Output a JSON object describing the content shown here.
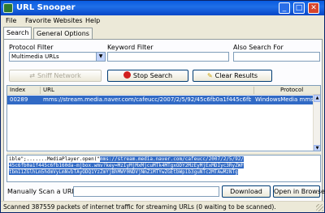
{
  "window": {
    "title": "URL Snooper"
  },
  "titlebar_buttons": {
    "minimize": "_",
    "maximize": "□",
    "close": "✕"
  },
  "menu": [
    "File",
    "Favorite Websites",
    "Help"
  ],
  "tabs": [
    "Search",
    "General Options"
  ],
  "filters": {
    "protocol_label": "Protocol Filter",
    "protocol_value": "Multimedia URLs",
    "keyword_label": "Keyword Filter",
    "keyword_value": "",
    "also_label": "Also Search For",
    "also_value": ""
  },
  "buttons": {
    "sniff": "Sniff Network",
    "stop": "Stop Search",
    "clear": "Clear Results",
    "download": "Download",
    "open_browser": "Open in Browser"
  },
  "grid": {
    "columns": [
      "Index",
      "URL",
      "Protocol"
    ],
    "rows": [
      {
        "index": "00289",
        "url": "mms://stream.media.naver.com/cafeucc/2007/2/5/92/45c6fb0a1f445c6fb160...",
        "protocol": "WindowsMedia mms stream"
      }
    ]
  },
  "detail": {
    "line1_prefix": "ible\";.......MediaPlayer.open(\"",
    "line1_sel": "mms://stream.media.naver.com/cafeucc/2007/2/5/92/",
    "line2_sel": "45c6fb0a1f445c6fb160da-mjbox.wmv?key=MzIyMjMxMjcuMTk4MTgxODY2MzEyMjExMDIyc3RyZWF",
    "line3_sel": "tbm11ZGlhLm5hdmVyLmNvbTAyODQ1YzZmYjBhMWY0NDVjNmZiMTYwZGEtbWpib3guNTc2MTAwMzNTg"
  },
  "manual": {
    "label": "Manually Scan a URL:",
    "value": ""
  },
  "status": "Scanned 387559 packets of internet traffic for streaming URLs (0 waiting to be scanned)."
}
